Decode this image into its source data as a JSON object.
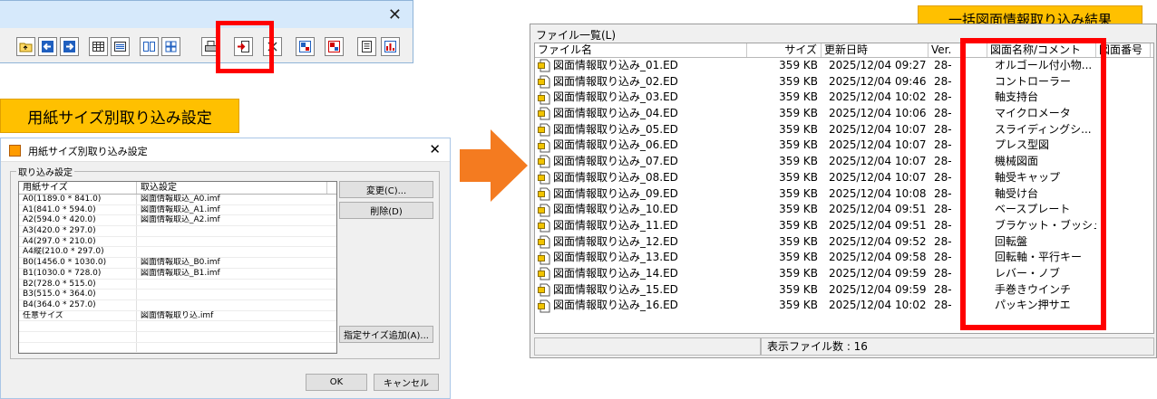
{
  "toolbar_window": {
    "close_glyph": "✕",
    "buttons": [
      "folder-up-icon",
      "arrow-left-icon",
      "arrow-right-icon",
      "grid-view-icon",
      "list-view-icon",
      "thumbnail-icon",
      "thumbnail-grid-icon",
      "print-icon",
      "import-icon",
      "delete-icon",
      "drawing-icon",
      "drawing-red-icon",
      "property-icon",
      "chart-icon"
    ]
  },
  "labels": {
    "left": "用紙サイズ別取り込み設定",
    "right": "一括図面情報取り込み結果"
  },
  "paper_dialog": {
    "title": "用紙サイズ別取り込み設定",
    "close_glyph": "✕",
    "group_label": "取り込み設定",
    "columns": [
      "用紙サイズ",
      "取込設定"
    ],
    "rows": [
      [
        "A0(1189.0 * 841.0)",
        "図面情報取込_A0.imf"
      ],
      [
        "A1(841.0 * 594.0)",
        "図面情報取込_A1.imf"
      ],
      [
        "A2(594.0 * 420.0)",
        "図面情報取込_A2.imf"
      ],
      [
        "A3(420.0 * 297.0)",
        ""
      ],
      [
        "A4(297.0 * 210.0)",
        ""
      ],
      [
        "A4縦(210.0 * 297.0)",
        ""
      ],
      [
        "B0(1456.0 * 1030.0)",
        "図面情報取込_B0.imf"
      ],
      [
        "B1(1030.0 * 728.0)",
        "図面情報取込_B1.imf"
      ],
      [
        "B2(728.0 * 515.0)",
        ""
      ],
      [
        "B3(515.0 * 364.0)",
        ""
      ],
      [
        "B4(364.0 * 257.0)",
        ""
      ],
      [
        "任意サイズ",
        "図面情報取り込.imf"
      ],
      [
        "",
        ""
      ],
      [
        "",
        ""
      ],
      [
        "",
        ""
      ]
    ],
    "buttons": {
      "change": "変更(C)...",
      "delete": "削除(D)",
      "add_size": "指定サイズ追加(A)...",
      "ok": "OK",
      "cancel": "キャンセル"
    }
  },
  "file_window": {
    "title": "ファイル一覧(L)",
    "columns": [
      "ファイル名",
      "サイズ",
      "更新日時",
      "Ver.",
      "図面名称/コメント",
      "図面番号"
    ],
    "rows": [
      [
        "図面情報取り込み_01.ED",
        "359 KB",
        "2025/12/04 09:27",
        "28-",
        "オルゴール付小物..."
      ],
      [
        "図面情報取り込み_02.ED",
        "359 KB",
        "2025/12/04 09:46",
        "28-",
        "コントローラー"
      ],
      [
        "図面情報取り込み_03.ED",
        "359 KB",
        "2025/12/04 10:02",
        "28-",
        "軸支持台"
      ],
      [
        "図面情報取り込み_04.ED",
        "359 KB",
        "2025/12/04 10:06",
        "28-",
        "マイクロメータ"
      ],
      [
        "図面情報取り込み_05.ED",
        "359 KB",
        "2025/12/04 10:07",
        "28-",
        "スライディングシ..."
      ],
      [
        "図面情報取り込み_06.ED",
        "359 KB",
        "2025/12/04 10:07",
        "28-",
        "プレス型図"
      ],
      [
        "図面情報取り込み_07.ED",
        "359 KB",
        "2025/12/04 10:07",
        "28-",
        "機械図面"
      ],
      [
        "図面情報取り込み_08.ED",
        "359 KB",
        "2025/12/04 10:07",
        "28-",
        "軸受キャップ"
      ],
      [
        "図面情報取り込み_09.ED",
        "359 KB",
        "2025/12/04 10:08",
        "28-",
        "軸受け台"
      ],
      [
        "図面情報取り込み_10.ED",
        "359 KB",
        "2025/12/04 09:51",
        "28-",
        "ベースプレート"
      ],
      [
        "図面情報取り込み_11.ED",
        "359 KB",
        "2025/12/04 09:51",
        "28-",
        "ブラケット・ブッシュ"
      ],
      [
        "図面情報取り込み_12.ED",
        "359 KB",
        "2025/12/04 09:52",
        "28-",
        "回転盤"
      ],
      [
        "図面情報取り込み_13.ED",
        "359 KB",
        "2025/12/04 09:58",
        "28-",
        "回転軸・平行キー"
      ],
      [
        "図面情報取り込み_14.ED",
        "359 KB",
        "2025/12/04 09:59",
        "28-",
        "レバー・ノブ"
      ],
      [
        "図面情報取り込み_15.ED",
        "359 KB",
        "2025/12/04 09:59",
        "28-",
        "手巻きウインチ"
      ],
      [
        "図面情報取り込み_16.ED",
        "359 KB",
        "2025/12/04 10:02",
        "28-",
        "パッキン押サエ"
      ]
    ],
    "status": "表示ファイル数 : 16"
  },
  "colors": {
    "highlight": "#ff0000",
    "label_bg": "#ffc000",
    "arrow": "#f47b20"
  }
}
